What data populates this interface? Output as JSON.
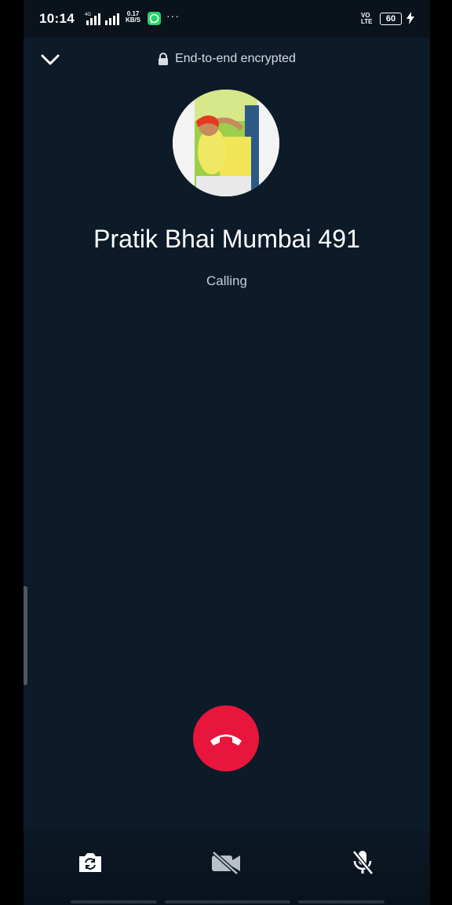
{
  "status_bar": {
    "time": "10:14",
    "network_tag": "4G",
    "speed_value": "0.17",
    "speed_unit": "KB/S",
    "volte_top": "VO",
    "volte_bottom": "LTE",
    "battery": "60",
    "more_dots": "···"
  },
  "header": {
    "encryption_label": "End-to-end encrypted"
  },
  "call": {
    "contact_name": "Pratik Bhai Mumbai 491",
    "call_status": "Calling"
  },
  "colors": {
    "background": "#0d1a28",
    "end_call": "#e8163d",
    "whatsapp_green": "#25d366"
  },
  "controls": {
    "icons": [
      "camera-switch-icon",
      "video-off-icon",
      "mic-off-icon"
    ]
  }
}
